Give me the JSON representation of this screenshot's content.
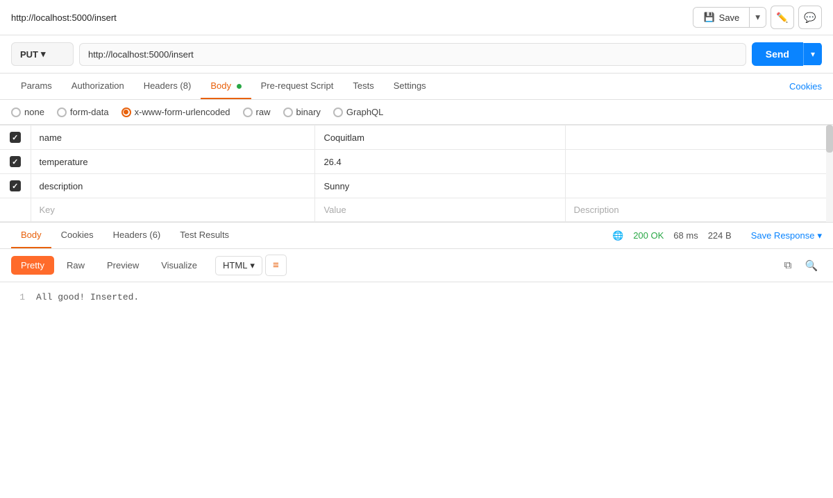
{
  "topbar": {
    "url": "http://localhost:5000/insert",
    "save_label": "Save"
  },
  "request": {
    "method": "PUT",
    "url": "http://localhost:5000/insert",
    "send_label": "Send"
  },
  "tabs": {
    "items": [
      {
        "id": "params",
        "label": "Params",
        "active": false,
        "has_dot": false
      },
      {
        "id": "authorization",
        "label": "Authorization",
        "active": false,
        "has_dot": false
      },
      {
        "id": "headers",
        "label": "Headers (8)",
        "active": false,
        "has_dot": false
      },
      {
        "id": "body",
        "label": "Body",
        "active": true,
        "has_dot": true
      },
      {
        "id": "pre-request",
        "label": "Pre-request Script",
        "active": false,
        "has_dot": false
      },
      {
        "id": "tests",
        "label": "Tests",
        "active": false,
        "has_dot": false
      },
      {
        "id": "settings",
        "label": "Settings",
        "active": false,
        "has_dot": false
      }
    ],
    "cookies_label": "Cookies"
  },
  "body_types": [
    {
      "id": "none",
      "label": "none",
      "checked": false
    },
    {
      "id": "form-data",
      "label": "form-data",
      "checked": false
    },
    {
      "id": "x-www-form-urlencoded",
      "label": "x-www-form-urlencoded",
      "checked": true
    },
    {
      "id": "raw",
      "label": "raw",
      "checked": false
    },
    {
      "id": "binary",
      "label": "binary",
      "checked": false
    },
    {
      "id": "graphql",
      "label": "GraphQL",
      "checked": false
    }
  ],
  "params_table": {
    "rows": [
      {
        "checked": true,
        "key": "name",
        "value": "Coquitlam",
        "description": ""
      },
      {
        "checked": true,
        "key": "temperature",
        "value": "26.4",
        "description": ""
      },
      {
        "checked": true,
        "key": "description",
        "value": "Sunny",
        "description": ""
      }
    ],
    "placeholder_key": "Key",
    "placeholder_value": "Value",
    "placeholder_description": "Description"
  },
  "response": {
    "tabs": [
      {
        "id": "body",
        "label": "Body",
        "active": true
      },
      {
        "id": "cookies",
        "label": "Cookies",
        "active": false
      },
      {
        "id": "headers",
        "label": "Headers (6)",
        "active": false
      },
      {
        "id": "test-results",
        "label": "Test Results",
        "active": false
      }
    ],
    "status": "200 OK",
    "time": "68 ms",
    "size": "224 B",
    "save_response_label": "Save Response",
    "view_tabs": [
      {
        "id": "pretty",
        "label": "Pretty",
        "active": true
      },
      {
        "id": "raw",
        "label": "Raw",
        "active": false
      },
      {
        "id": "preview",
        "label": "Preview",
        "active": false
      },
      {
        "id": "visualize",
        "label": "Visualize",
        "active": false
      }
    ],
    "format": "HTML",
    "body_lines": [
      {
        "line": 1,
        "text": "All good! Inserted."
      }
    ]
  }
}
